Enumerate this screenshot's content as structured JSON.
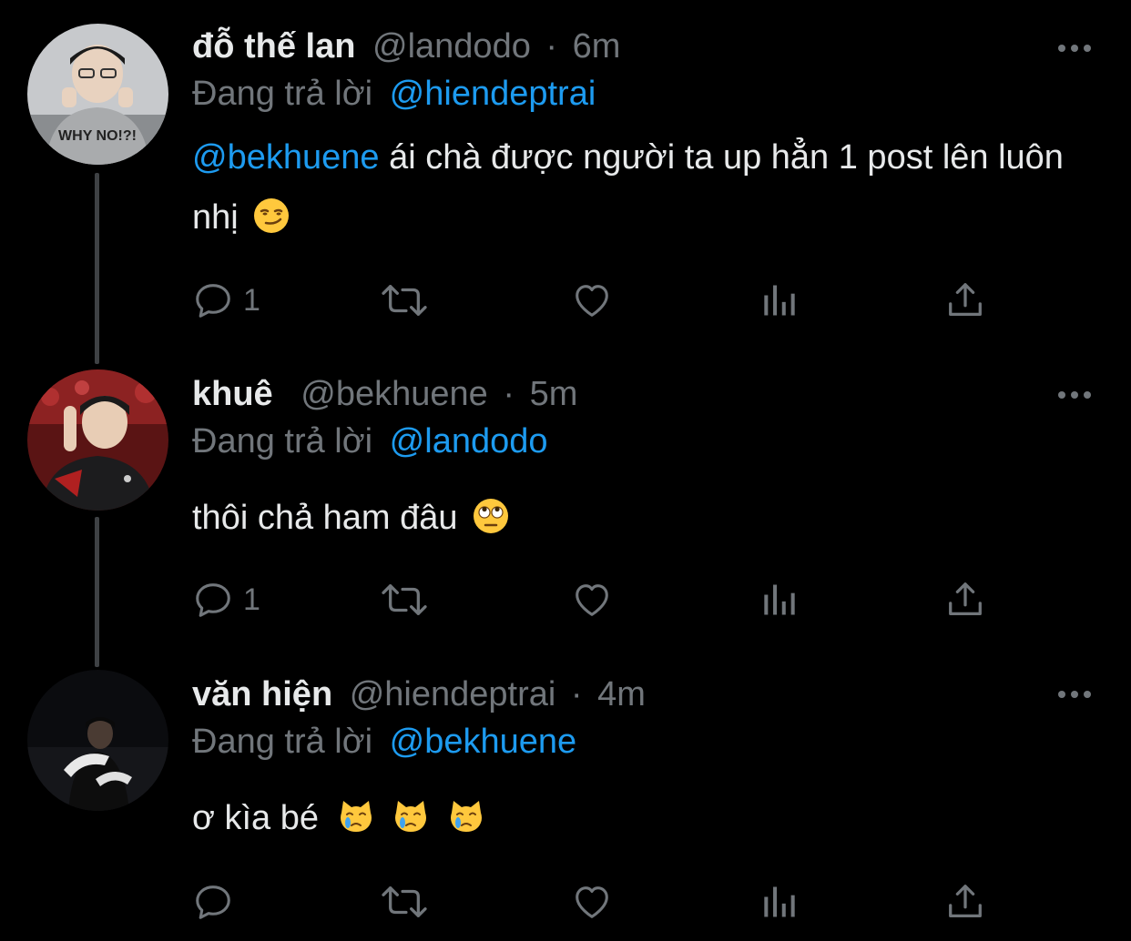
{
  "colors": {
    "background": "#000000",
    "text": "#e7e9ea",
    "secondary": "#71767b",
    "mention": "#1d9bf0",
    "thread_line": "#3e4144"
  },
  "tweets": [
    {
      "name": "đỗ thế lan",
      "handle": "@landodo",
      "separator": "·",
      "time": "6m",
      "reply_prefix": "Đang trả lời",
      "reply_to": "@hiendeptrai",
      "mention": "@bekhuene",
      "text": "ái chà được người ta up hẳn 1 post lên luôn nhị",
      "emojis": [
        "smirking-face"
      ],
      "reply_count": "1"
    },
    {
      "name": "khuê",
      "handle": "@bekhuene",
      "separator": "·",
      "time": "5m",
      "reply_prefix": "Đang trả lời",
      "reply_to": "@landodo",
      "text": "thôi chả ham đâu",
      "emojis": [
        "face-with-rolling-eyes"
      ],
      "reply_count": "1"
    },
    {
      "name": "văn hiện",
      "handle": "@hiendeptrai",
      "separator": "·",
      "time": "4m",
      "reply_prefix": "Đang trả lời",
      "reply_to": "@bekhuene",
      "text": "ơ kìa bé",
      "emojis": [
        "crying-cat-face",
        "crying-cat-face",
        "crying-cat-face"
      ],
      "reply_count": ""
    }
  ],
  "icons": {
    "reply": "reply-icon",
    "retweet": "retweet-icon",
    "like": "like-icon",
    "analytics": "analytics-icon",
    "share": "share-icon",
    "more": "more-icon"
  }
}
